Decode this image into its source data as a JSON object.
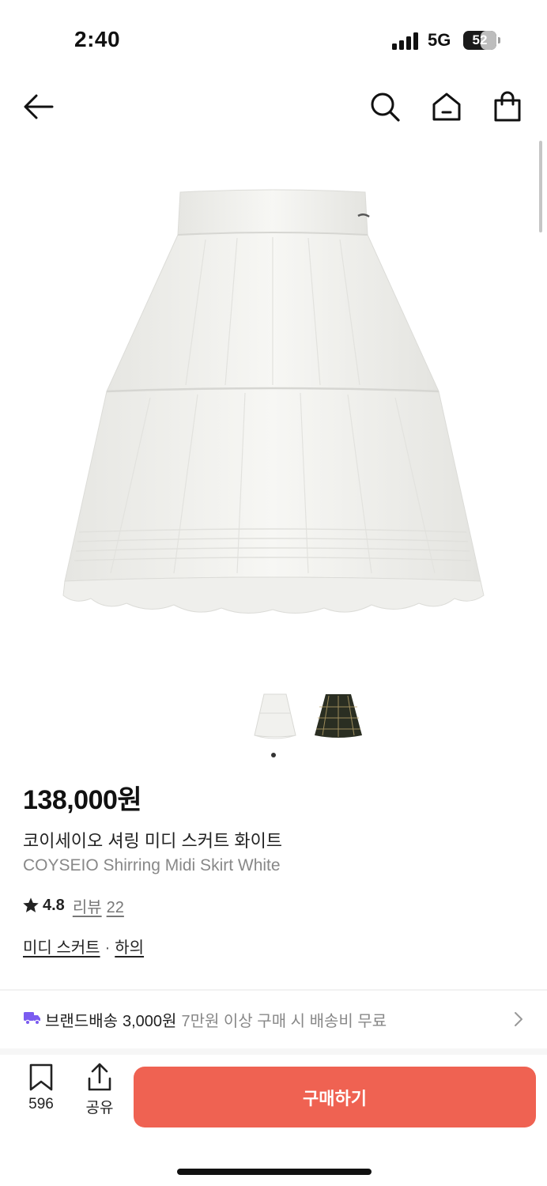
{
  "status_bar": {
    "time": "2:40",
    "network": "5G",
    "battery_level": "52",
    "battery_fraction": 0.52
  },
  "nav": {
    "back_icon": "arrow-left-icon",
    "search_icon": "search-icon",
    "home_icon": "home-icon",
    "cart_icon": "shopping-bag-icon"
  },
  "gallery": {
    "hero_image": "white tiered midi skirt photo",
    "thumbnails": [
      "white skirt thumbnail",
      "dark plaid skirt thumbnail"
    ],
    "active_index": 0,
    "page_dots": 1
  },
  "product": {
    "price": "138,000원",
    "name_ko": "코이세이오 셔링 미디 스커트 화이트",
    "name_en": "COYSEIO Shirring Midi Skirt White",
    "rating": "4.8",
    "review_label": "리뷰",
    "review_count": "22",
    "category": "미디 스커트",
    "category_separator": "·",
    "parent_category": "하의"
  },
  "shipping": {
    "label": "브랜드배송",
    "fee": "3,000원",
    "free_condition": "7만원 이상 구매 시 배송비 무료"
  },
  "bottom_bar": {
    "wishlist_count": "596",
    "share_label": "공유",
    "buy_label": "구매하기"
  },
  "colors": {
    "accent": "#ef6252",
    "truck_icon": "#7b5cf0",
    "text_muted": "#888888"
  }
}
